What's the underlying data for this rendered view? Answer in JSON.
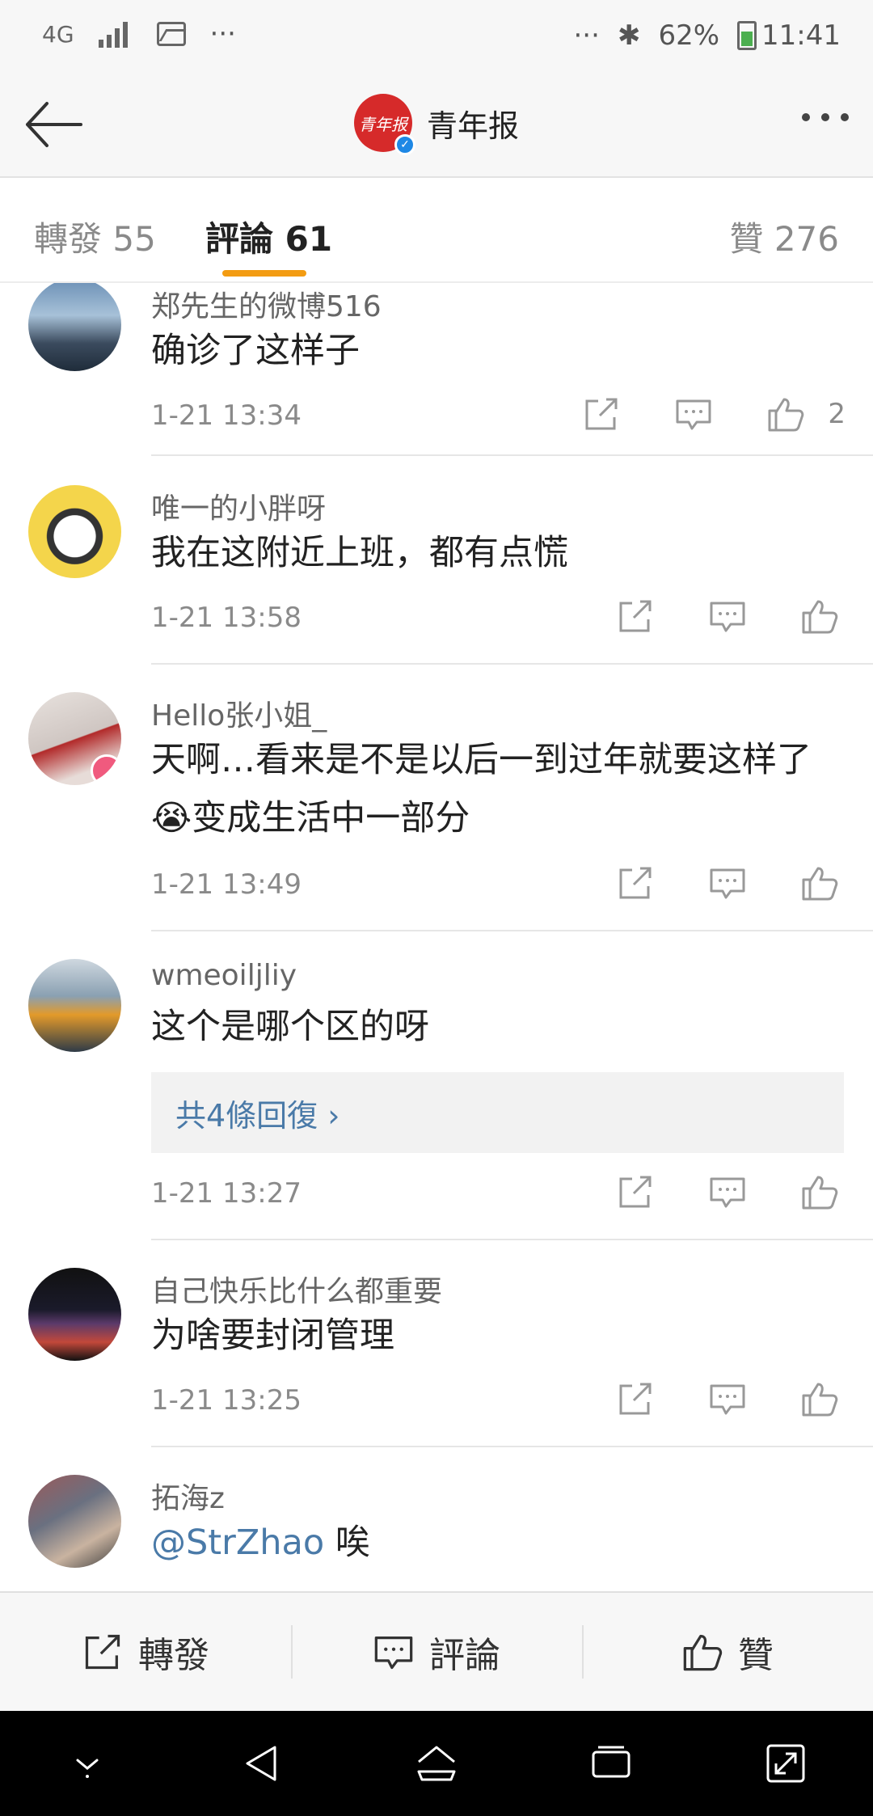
{
  "status_bar": {
    "network": "4G",
    "left_more": "···",
    "right_more": "···",
    "battery": "62%",
    "time": "11:41"
  },
  "header": {
    "logo_text": "青年报",
    "title": "青年报"
  },
  "tabs": {
    "forward": "轉發 55",
    "comment": "評論 61",
    "like": "贊 276"
  },
  "comments": [
    {
      "name": "郑先生的微博516",
      "text": "确诊了这样子",
      "time": "1-21 13:34",
      "likes": "2"
    },
    {
      "name": "唯一的小胖呀",
      "text": "我在这附近上班，都有点慌",
      "time": "1-21 13:58",
      "likes": ""
    },
    {
      "name": "Hello张小姐_",
      "text": "天啊…看来是不是以后一到过年就要这样了😭变成生活中一部分",
      "time": "1-21 13:49",
      "likes": ""
    },
    {
      "name": "wmeoiljliy",
      "text": "这个是哪个区的呀",
      "replies": "共4條回復 ›",
      "time": "1-21 13:27",
      "likes": ""
    },
    {
      "name": "自己快乐比什么都重要",
      "text": "为啥要封闭管理",
      "time": "1-21 13:25",
      "likes": ""
    },
    {
      "name": "拓海z",
      "mention": "@StrZhao",
      "text": " 唉",
      "time": "",
      "likes": ""
    }
  ],
  "bottom_bar": {
    "forward": "轉發",
    "comment": "評論",
    "like": "贊"
  },
  "colors": {
    "accent": "#f39c12",
    "link": "#4a7aa8",
    "logo_red": "#d62a2a",
    "verified_blue": "#1e88e5"
  }
}
